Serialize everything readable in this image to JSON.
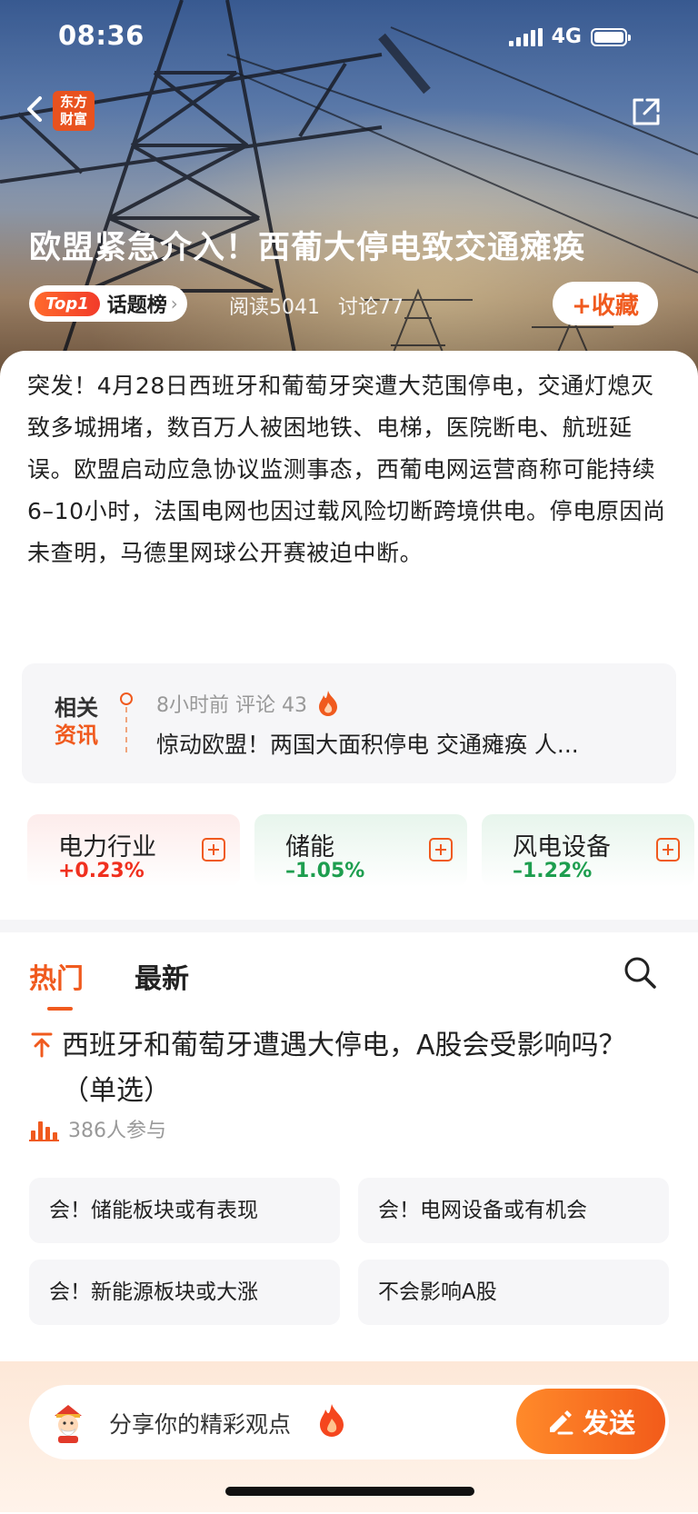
{
  "status": {
    "time": "08:36",
    "network": "4G"
  },
  "header": {
    "logo_text": "东方财富",
    "logo_line1": "东方",
    "logo_line2": "财富"
  },
  "topic": {
    "title": "欧盟紧急介入！西葡大停电致交通瘫痪",
    "rank_badge": "Top1",
    "rank_label": "话题榜",
    "reads": "阅读5041",
    "discussions": "讨论77",
    "favorite_label": "+收藏"
  },
  "summary": "突发！4月28日西班牙和葡萄牙突遭大范围停电，交通灯熄灭致多城拥堵，数百万人被困地铁、电梯，医院断电、航班延误。欧盟启动应急协议监测事态，西葡电网运营商称可能持续6–10小时，法国电网也因过载风险切断跨境供电。停电原因尚未查明，马德里网球公开赛被迫中断。",
  "related": {
    "badge_line1": "相关",
    "badge_line2": "资讯",
    "meta": "8小时前 评论 43",
    "title": "惊动欧盟！两国大面积停电 交通瘫痪 人..."
  },
  "sectors": [
    {
      "name": "电力行业",
      "change": "+0.23%",
      "direction": "up"
    },
    {
      "name": "储能",
      "change": "–1.05%",
      "direction": "down"
    },
    {
      "name": "风电设备",
      "change": "–1.22%",
      "direction": "down"
    }
  ],
  "tabs": {
    "hot": "热门",
    "latest": "最新"
  },
  "poll": {
    "question": "西班牙和葡萄牙遭遇大停电，A股会受影响吗？ （单选）",
    "participants": "386人参与",
    "options": [
      "会！储能板块或有表现",
      "会！电网设备或有机会",
      "会！新能源板块或大涨",
      "不会影响A股"
    ]
  },
  "composer": {
    "placeholder": "分享你的精彩观点",
    "send_label": "发送"
  },
  "colors": {
    "accent": "#f05a1e",
    "up": "#f0301f",
    "down": "#1e9e4f"
  },
  "icons": [
    "back-icon",
    "share-icon",
    "search-icon",
    "fire-icon",
    "edit-icon",
    "pin-top-icon",
    "bar-chart-icon",
    "plus-icon"
  ]
}
